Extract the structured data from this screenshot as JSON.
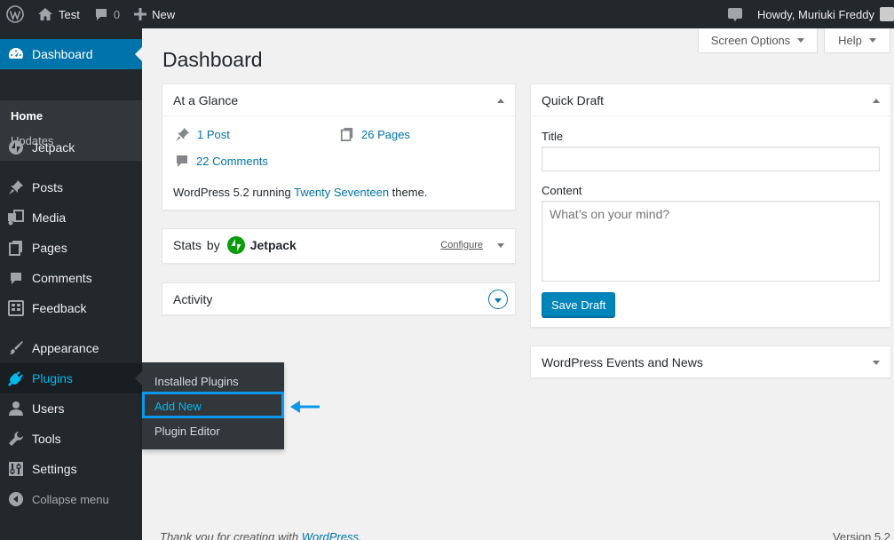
{
  "adminbar": {
    "site_name": "Test",
    "comments_count": "0",
    "new_label": "New",
    "howdy": "Howdy, Muriuki Freddy"
  },
  "sidebar": {
    "dashboard": "Dashboard",
    "home": "Home",
    "updates": "Updates",
    "items": [
      {
        "label": "Jetpack",
        "icon": "jetpack-icon"
      },
      {
        "label": "Posts",
        "icon": "pin-icon"
      },
      {
        "label": "Media",
        "icon": "media-icon"
      },
      {
        "label": "Pages",
        "icon": "pages-icon"
      },
      {
        "label": "Comments",
        "icon": "comment-icon"
      },
      {
        "label": "Feedback",
        "icon": "feedback-icon"
      },
      {
        "label": "Appearance",
        "icon": "brush-icon"
      },
      {
        "label": "Plugins",
        "icon": "plugin-icon"
      },
      {
        "label": "Users",
        "icon": "user-icon"
      },
      {
        "label": "Tools",
        "icon": "wrench-icon"
      },
      {
        "label": "Settings",
        "icon": "settings-icon"
      }
    ],
    "collapse": "Collapse menu"
  },
  "flyout": {
    "installed": "Installed Plugins",
    "add_new": "Add New",
    "editor": "Plugin Editor"
  },
  "header": {
    "screen_options": "Screen Options",
    "help": "Help",
    "title": "Dashboard"
  },
  "glance": {
    "title": "At a Glance",
    "posts": "1 Post",
    "pages": "26 Pages",
    "comments": "22 Comments",
    "running_prefix": "WordPress 5.2 running ",
    "theme": "Twenty Seventeen",
    "running_suffix": " theme."
  },
  "stats": {
    "title": "Stats",
    "by": "by",
    "brand": "Jetpack",
    "configure": "Configure"
  },
  "activity": {
    "title": "Activity"
  },
  "quickdraft": {
    "title": "Quick Draft",
    "title_label": "Title",
    "content_label": "Content",
    "content_placeholder": "What’s on your mind?",
    "save": "Save Draft"
  },
  "events": {
    "title": "WordPress Events and News"
  },
  "footer": {
    "thanks_prefix": "Thank you for creating with ",
    "thanks_link": "WordPress",
    "thanks_suffix": ".",
    "version": "Version 5.2"
  },
  "colors": {
    "accent": "#0073aa",
    "menu_bg": "#23282d",
    "highlight": "#0a97ec"
  }
}
